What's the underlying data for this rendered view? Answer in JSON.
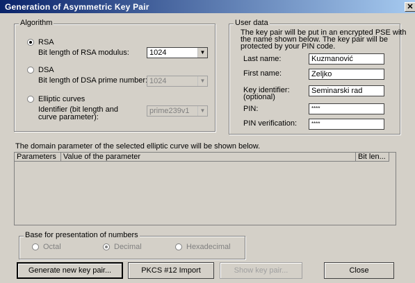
{
  "window": {
    "title": "Generation of Asymmetric Key Pair",
    "close_glyph": "✕"
  },
  "algorithm": {
    "legend": "Algorithm",
    "rsa": {
      "label": "RSA",
      "param_label": "Bit length of RSA modulus:",
      "value": "1024",
      "selected": true,
      "enabled": true
    },
    "dsa": {
      "label": "DSA",
      "param_label": "Bit length of DSA prime number:",
      "value": "1024",
      "selected": false,
      "enabled": false
    },
    "ec": {
      "label": "Elliptic curves",
      "param_label_1": "Identifier (bit length and",
      "param_label_2": "curve parameter):",
      "value": "prime239v1",
      "selected": false,
      "enabled": false
    }
  },
  "user_data": {
    "legend": "User data",
    "info_1": "The key pair will be put in an encrypted PSE with",
    "info_2": "the name shown below. The key pair will be",
    "info_3": "protected by your PIN code.",
    "last_name_label": "Last name:",
    "last_name": "Kuzmanović",
    "first_name_label": "First name:",
    "first_name": "Zeljko",
    "key_id_label_1": "Key identifier:",
    "key_id_label_2": "(optional)",
    "key_id": "Seminarski rad",
    "pin_label": "PIN:",
    "pin": "****",
    "pin_verify_label": "PIN verification:",
    "pin_verify": "****"
  },
  "domain": {
    "caption": "The domain parameter of the selected elliptic curve will be shown below.",
    "columns": [
      "Parameters",
      "Value of the parameter",
      "Bit len..."
    ]
  },
  "base": {
    "legend": "Base for presentation of numbers",
    "options": [
      {
        "label": "Octal",
        "selected": false
      },
      {
        "label": "Decimal",
        "selected": true
      },
      {
        "label": "Hexadecimal",
        "selected": false
      }
    ]
  },
  "buttons": {
    "generate": "Generate new key pair...",
    "pkcs": "PKCS #12 Import",
    "show": "Show key pair...",
    "close": "Close"
  },
  "colors": {
    "title_start": "#0a246a",
    "title_end": "#a6caf0",
    "face": "#d4d0c8"
  }
}
